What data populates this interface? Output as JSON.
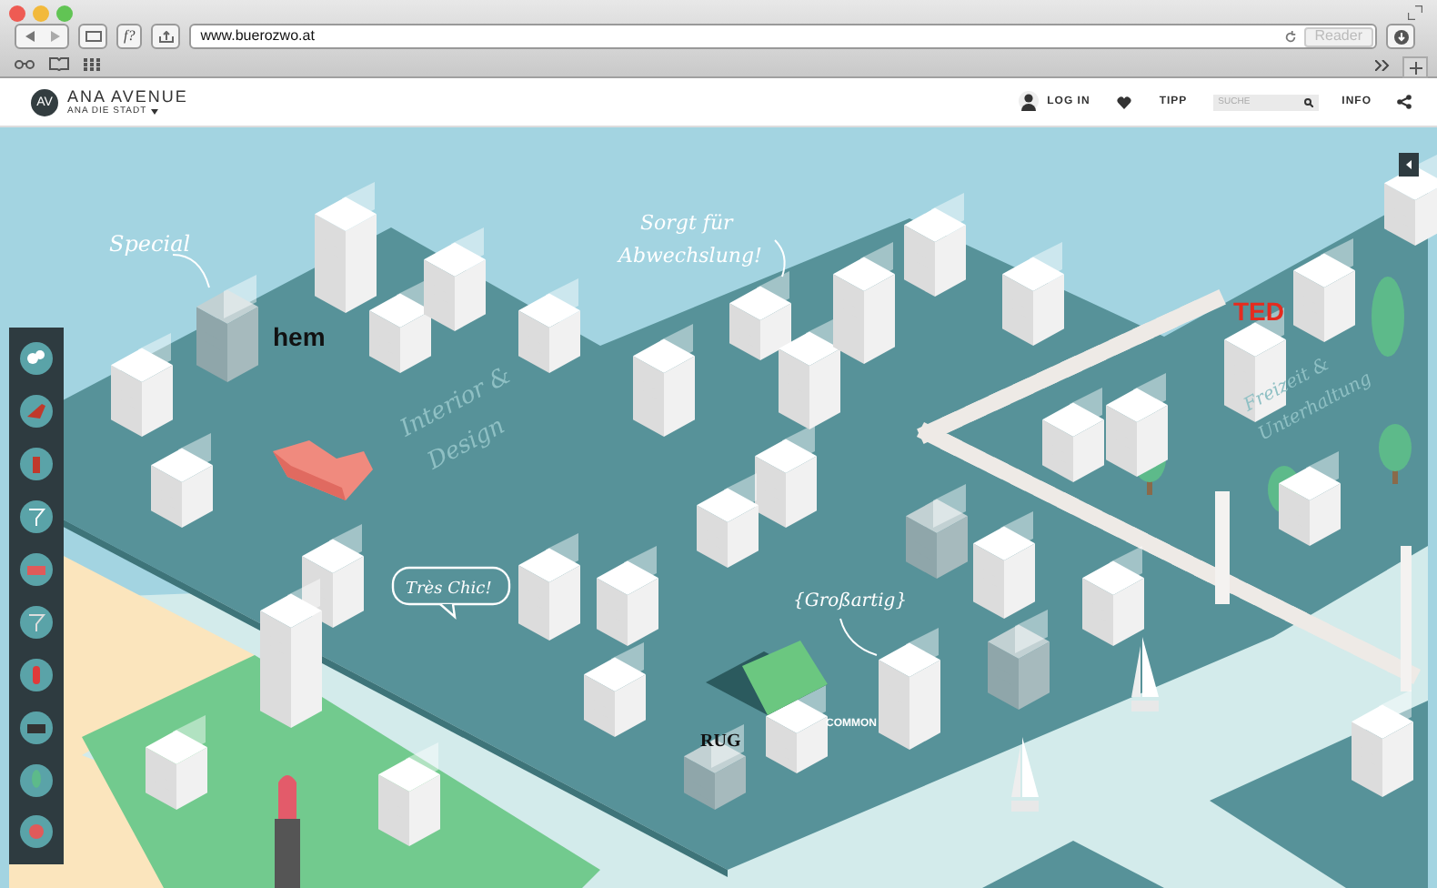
{
  "browser": {
    "url": "www.buerozwo.at",
    "reader_button": "Reader",
    "script_button": "f?"
  },
  "header": {
    "logo_mark": "AV",
    "brand": "ANA AVENUE",
    "city_menu": "ANA DIE STADT",
    "login": "LOG IN",
    "tip": "TIPP",
    "search": {
      "placeholder": "SUCHE"
    },
    "info": "INFO"
  },
  "map": {
    "labels": [
      {
        "text": "Special"
      },
      {
        "text": "Sorgt für"
      },
      {
        "text": "Abwechslung!"
      },
      {
        "text": "Interior &"
      },
      {
        "text": "Design"
      },
      {
        "text": "Très Chic!"
      },
      {
        "text": "{Großartig}"
      },
      {
        "text": "Freizeit &"
      },
      {
        "text": "Unterhaltung"
      }
    ],
    "store_logos": [
      {
        "text": "hem"
      },
      {
        "text": "TED"
      },
      {
        "text": "RUG"
      },
      {
        "text": "COMMON"
      }
    ]
  }
}
